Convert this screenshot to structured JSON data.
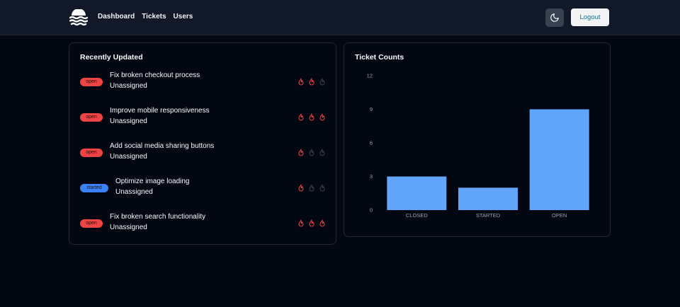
{
  "nav": {
    "items": [
      "Dashboard",
      "Tickets",
      "Users"
    ]
  },
  "header": {
    "logout_label": "Logout"
  },
  "recent": {
    "title": "Recently Updated",
    "tickets": [
      {
        "status": "open",
        "title": "Fix broken checkout process",
        "assignee": "Unassigned",
        "priority": 2
      },
      {
        "status": "open",
        "title": "Improve mobile responsiveness",
        "assignee": "Unassigned",
        "priority": 3
      },
      {
        "status": "open",
        "title": "Add social media sharing buttons",
        "assignee": "Unassigned",
        "priority": 1
      },
      {
        "status": "started",
        "title": "Optimize image loading",
        "assignee": "Unassigned",
        "priority": 1
      },
      {
        "status": "open",
        "title": "Fix broken search functionality",
        "assignee": "Unassigned",
        "priority": 3
      }
    ]
  },
  "counts": {
    "title": "Ticket Counts"
  },
  "colors": {
    "open": "#ef4444",
    "started": "#3b82f6",
    "bar": "#60a5fa",
    "flame_active": "#ef4444",
    "flame_inactive": "#374151"
  },
  "chart_data": {
    "type": "bar",
    "categories": [
      "CLOSED",
      "STARTED",
      "OPEN"
    ],
    "values": [
      3,
      2,
      9
    ],
    "ylim": [
      0,
      12
    ],
    "yticks": [
      0,
      3,
      6,
      9,
      12
    ],
    "grid": false,
    "legend": "none"
  }
}
